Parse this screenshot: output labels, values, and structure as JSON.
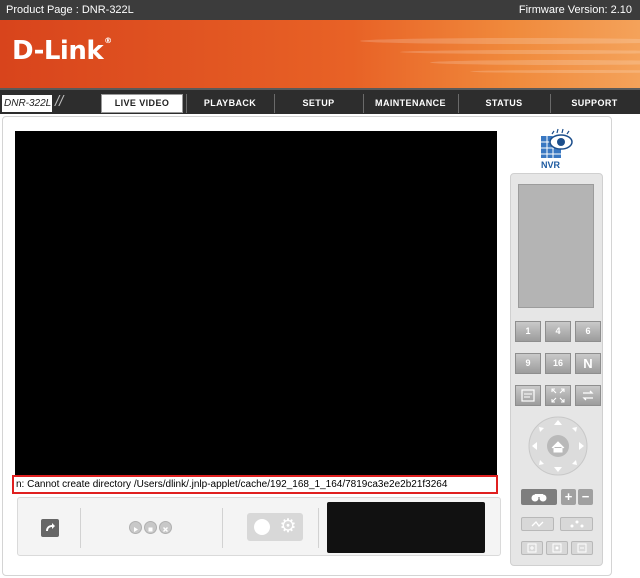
{
  "header": {
    "product_label": "Product Page : DNR-322L",
    "firmware_label": "Firmware Version: 2.10"
  },
  "banner": {
    "logo_text": "D-Link",
    "logo_mark": "®"
  },
  "nav": {
    "model": "DNR-322L",
    "tabs": [
      {
        "label": "LIVE VIDEO",
        "active": true
      },
      {
        "label": "PLAYBACK",
        "active": false
      },
      {
        "label": "SETUP",
        "active": false
      },
      {
        "label": "MAINTENANCE",
        "active": false
      },
      {
        "label": "STATUS",
        "active": false
      },
      {
        "label": "SUPPORT",
        "active": false
      }
    ]
  },
  "video": {
    "error_message": "n: Cannot create directory /Users/dlink/.jnlp-applet/cache/192_168_1_164/7819ca3e2e2b21f3264"
  },
  "nvr": {
    "label": "NVR"
  },
  "layout_buttons": {
    "row1": [
      "1",
      "4",
      "6"
    ],
    "row2": [
      "9",
      "16",
      "N"
    ]
  },
  "zoom": {
    "plus": "+",
    "minus": "−"
  },
  "colors": {
    "brand_orange": "#e86226",
    "error_border": "#e02020",
    "nav_bg": "#2d2d2d"
  }
}
